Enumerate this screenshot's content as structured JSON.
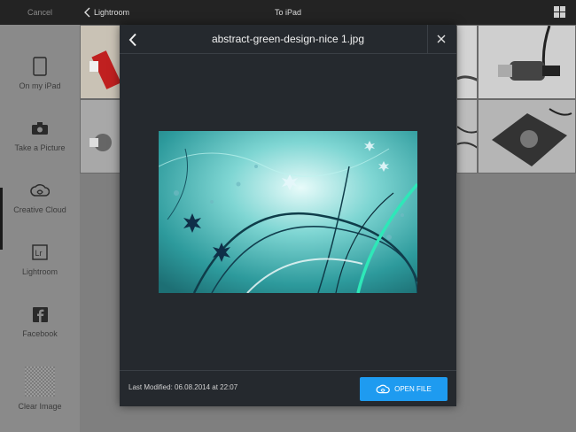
{
  "topbar": {
    "cancel_label": "Cancel",
    "back_label": "Lightroom",
    "title": "To iPad"
  },
  "sidebar": {
    "items": [
      {
        "label": "On my iPad",
        "icon": "ipad-icon"
      },
      {
        "label": "Take a Picture",
        "icon": "camera-icon"
      },
      {
        "label": "Creative Cloud",
        "icon": "creative-cloud-icon",
        "active": true
      },
      {
        "label": "Lightroom",
        "icon": "lightroom-icon"
      },
      {
        "label": "Facebook",
        "icon": "facebook-icon"
      },
      {
        "label": "Clear Image",
        "icon": "checkerboard-icon"
      }
    ]
  },
  "modal": {
    "title": "abstract-green-design-nice 1.jpg",
    "last_modified": "Last Modified: 06.08.2014 at 22:07",
    "open_label": "OPEN FILE"
  },
  "colors": {
    "accent": "#1e9bf0",
    "modal_bg": "#25292e",
    "topbar_bg": "#232323"
  }
}
